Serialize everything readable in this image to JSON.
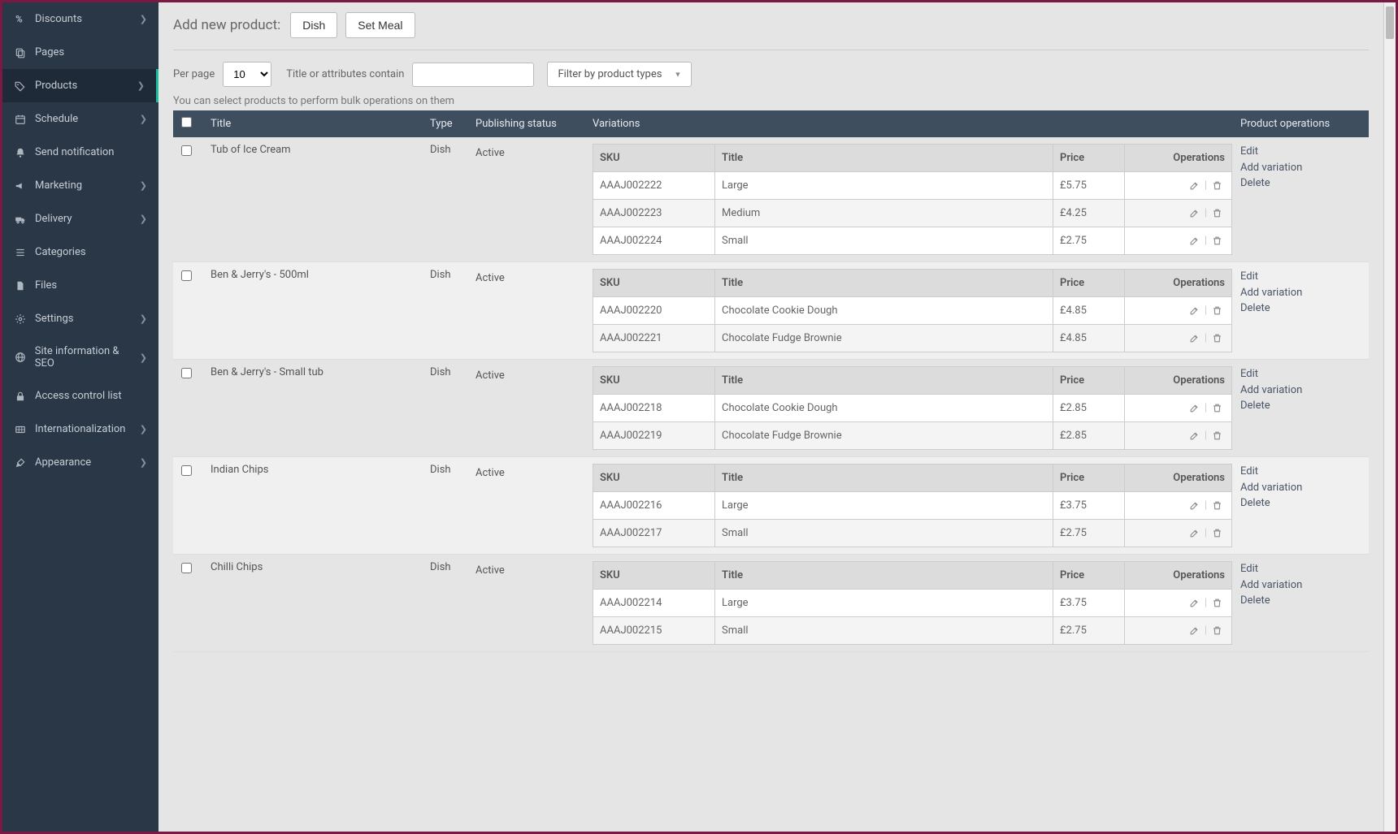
{
  "sidebar": {
    "items": [
      {
        "icon": "percent",
        "label": "Discounts",
        "hasSub": true,
        "active": false
      },
      {
        "icon": "copy",
        "label": "Pages",
        "hasSub": false,
        "active": false
      },
      {
        "icon": "tags",
        "label": "Products",
        "hasSub": true,
        "active": true
      },
      {
        "icon": "calendar",
        "label": "Schedule",
        "hasSub": true,
        "active": false
      },
      {
        "icon": "bell",
        "label": "Send notification",
        "hasSub": false,
        "active": false
      },
      {
        "icon": "bullhorn",
        "label": "Marketing",
        "hasSub": true,
        "active": false
      },
      {
        "icon": "truck",
        "label": "Delivery",
        "hasSub": true,
        "active": false
      },
      {
        "icon": "list",
        "label": "Categories",
        "hasSub": false,
        "active": false
      },
      {
        "icon": "file",
        "label": "Files",
        "hasSub": false,
        "active": false
      },
      {
        "icon": "cog",
        "label": "Settings",
        "hasSub": true,
        "active": false
      },
      {
        "icon": "globe",
        "label": "Site information & SEO",
        "hasSub": true,
        "active": false
      },
      {
        "icon": "lock",
        "label": "Access control list",
        "hasSub": false,
        "active": false
      },
      {
        "icon": "i18n",
        "label": "Internationalization",
        "hasSub": true,
        "active": false
      },
      {
        "icon": "brush",
        "label": "Appearance",
        "hasSub": true,
        "active": false
      }
    ]
  },
  "header": {
    "addLabel": "Add new product:",
    "btn1": "Dish",
    "btn2": "Set Meal"
  },
  "filters": {
    "perPageLabel": "Per page",
    "perPageValue": "10",
    "searchLabel": "Title or attributes contain",
    "typeFilter": "Filter by product types"
  },
  "hint": "You can select products to perform bulk operations on them",
  "columns": {
    "title": "Title",
    "type": "Type",
    "status": "Publishing status",
    "variations": "Variations",
    "productOps": "Product operations"
  },
  "varCols": {
    "sku": "SKU",
    "title": "Title",
    "price": "Price",
    "ops": "Operations"
  },
  "opLabels": {
    "edit": "Edit",
    "addVar": "Add variation",
    "delete": "Delete"
  },
  "products": [
    {
      "title": "Tub of Ice Cream",
      "type": "Dish",
      "status": "Active",
      "variations": [
        {
          "sku": "AAAJ002222",
          "title": "Large",
          "price": "£5.75"
        },
        {
          "sku": "AAAJ002223",
          "title": "Medium",
          "price": "£4.25"
        },
        {
          "sku": "AAAJ002224",
          "title": "Small",
          "price": "£2.75"
        }
      ]
    },
    {
      "title": "Ben & Jerry's - 500ml",
      "type": "Dish",
      "status": "Active",
      "variations": [
        {
          "sku": "AAAJ002220",
          "title": "Chocolate Cookie Dough",
          "price": "£4.85"
        },
        {
          "sku": "AAAJ002221",
          "title": "Chocolate Fudge Brownie",
          "price": "£4.85"
        }
      ]
    },
    {
      "title": "Ben & Jerry's - Small tub",
      "type": "Dish",
      "status": "Active",
      "variations": [
        {
          "sku": "AAAJ002218",
          "title": "Chocolate Cookie Dough",
          "price": "£2.85"
        },
        {
          "sku": "AAAJ002219",
          "title": "Chocolate Fudge Brownie",
          "price": "£2.85"
        }
      ]
    },
    {
      "title": "Indian Chips",
      "type": "Dish",
      "status": "Active",
      "variations": [
        {
          "sku": "AAAJ002216",
          "title": "Large",
          "price": "£3.75"
        },
        {
          "sku": "AAAJ002217",
          "title": "Small",
          "price": "£2.75"
        }
      ]
    },
    {
      "title": "Chilli Chips",
      "type": "Dish",
      "status": "Active",
      "variations": [
        {
          "sku": "AAAJ002214",
          "title": "Large",
          "price": "£3.75"
        },
        {
          "sku": "AAAJ002215",
          "title": "Small",
          "price": "£2.75"
        }
      ]
    }
  ]
}
